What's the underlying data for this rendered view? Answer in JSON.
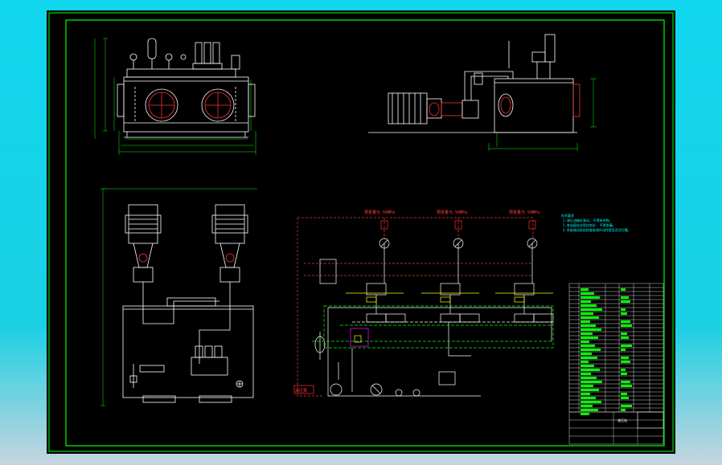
{
  "drawing": {
    "colors": {
      "background": "#000000",
      "frame": "#00ff00",
      "line": "#ffffff",
      "pressure_line": "#ff3030",
      "accent": "#00ffff",
      "magenta": "#ff00ff",
      "yellow": "#ffff00"
    },
    "schematic_labels": {
      "pressure_set_1": "预变量为 50MPa",
      "pressure_set_2": "预变量为 50MPa",
      "pressure_set_3": "预变量为 50MPa",
      "pump_label": "液压泵"
    },
    "notes": {
      "title": "技术要求",
      "lines": [
        "1.液压油箱应清洁, 不得有杂物。",
        "2.各连接处应密封良好, 不得渗漏。",
        "3.系统调试前应检查各阀件动作是否灵活可靠。"
      ]
    },
    "title_block": {
      "name": "液压站"
    }
  }
}
